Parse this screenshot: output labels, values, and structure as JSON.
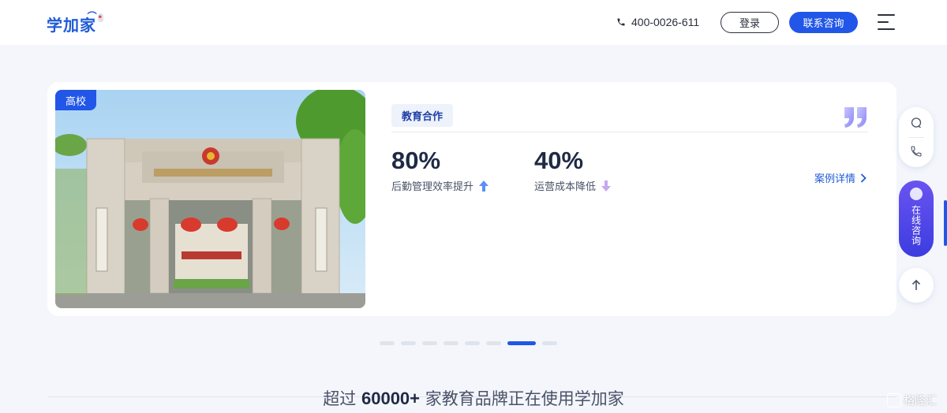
{
  "header": {
    "logo_text": "学加家",
    "phone": "400-0026-611",
    "login_label": "登录",
    "contact_label": "联系咨询"
  },
  "card": {
    "tag": "高校",
    "category": "教育合作",
    "stats": [
      {
        "value": "80%",
        "desc": "后勤管理效率提升",
        "trend": "up"
      },
      {
        "value": "40%",
        "desc": "运营成本降低",
        "trend": "down"
      }
    ],
    "case_link": "案例详情"
  },
  "pagination": {
    "total": 8,
    "active_index": 6
  },
  "tagline": {
    "prefix": "超过 ",
    "number": "60000+",
    "suffix": " 家教育品牌正在使用学加家"
  },
  "float": {
    "online_label": "在线咨询"
  },
  "watermark": "格隆汇",
  "colors": {
    "brand": "#2156e8",
    "online_gradient_top": "#6a54f0",
    "text_dark": "#1f2a44"
  }
}
